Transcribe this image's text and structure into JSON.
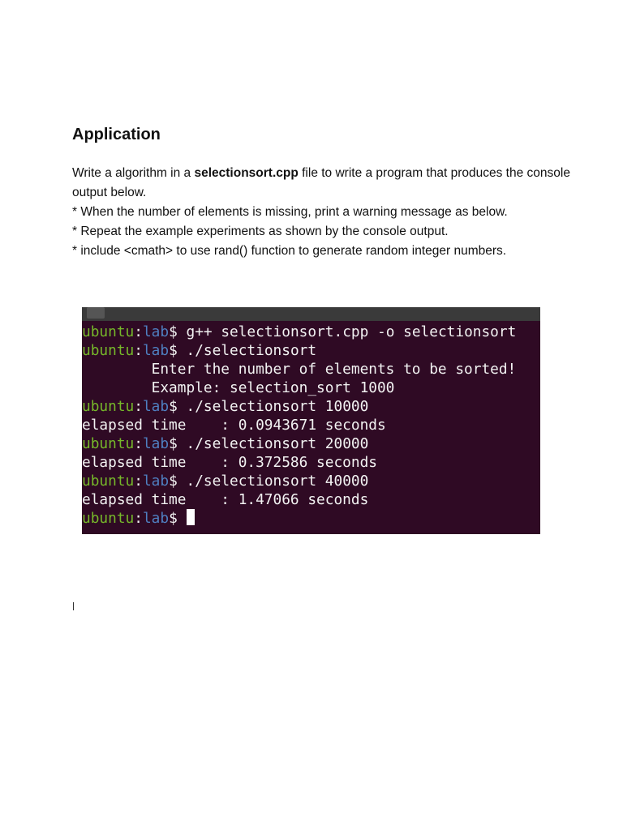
{
  "heading": "Application",
  "paragraph": {
    "intro_prefix": "Write a algorithm in a ",
    "intro_file": "selectionsort.cpp",
    "intro_suffix": " file to write a program that produces the console output below.",
    "bullets": [
      "* When the number of elements is missing, print a warning message as below.",
      "* Repeat the example experiments as shown by the console output.",
      "* include <cmath> to use rand() function to generate random integer numbers."
    ]
  },
  "terminal": {
    "user": "ubuntu",
    "dir": "lab",
    "prompt_suffix": "$ ",
    "lines": [
      {
        "type": "cmd",
        "text": "g++ selectionsort.cpp -o selectionsort"
      },
      {
        "type": "cmd",
        "text": "./selectionsort"
      },
      {
        "type": "out",
        "text": "        Enter the number of elements to be sorted!"
      },
      {
        "type": "out",
        "text": "        Example: selection_sort 1000"
      },
      {
        "type": "cmd",
        "text": "./selectionsort 10000"
      },
      {
        "type": "out",
        "text": "elapsed time    : 0.0943671 seconds"
      },
      {
        "type": "cmd",
        "text": "./selectionsort 20000"
      },
      {
        "type": "out",
        "text": "elapsed time    : 0.372586 seconds"
      },
      {
        "type": "cmd",
        "text": "./selectionsort 40000"
      },
      {
        "type": "out",
        "text": "elapsed time    : 1.47066 seconds"
      },
      {
        "type": "cmd",
        "text": ""
      }
    ],
    "colors": {
      "background": "#2f0a24",
      "user": "#76b82a",
      "dir": "#4f7fc0"
    }
  }
}
